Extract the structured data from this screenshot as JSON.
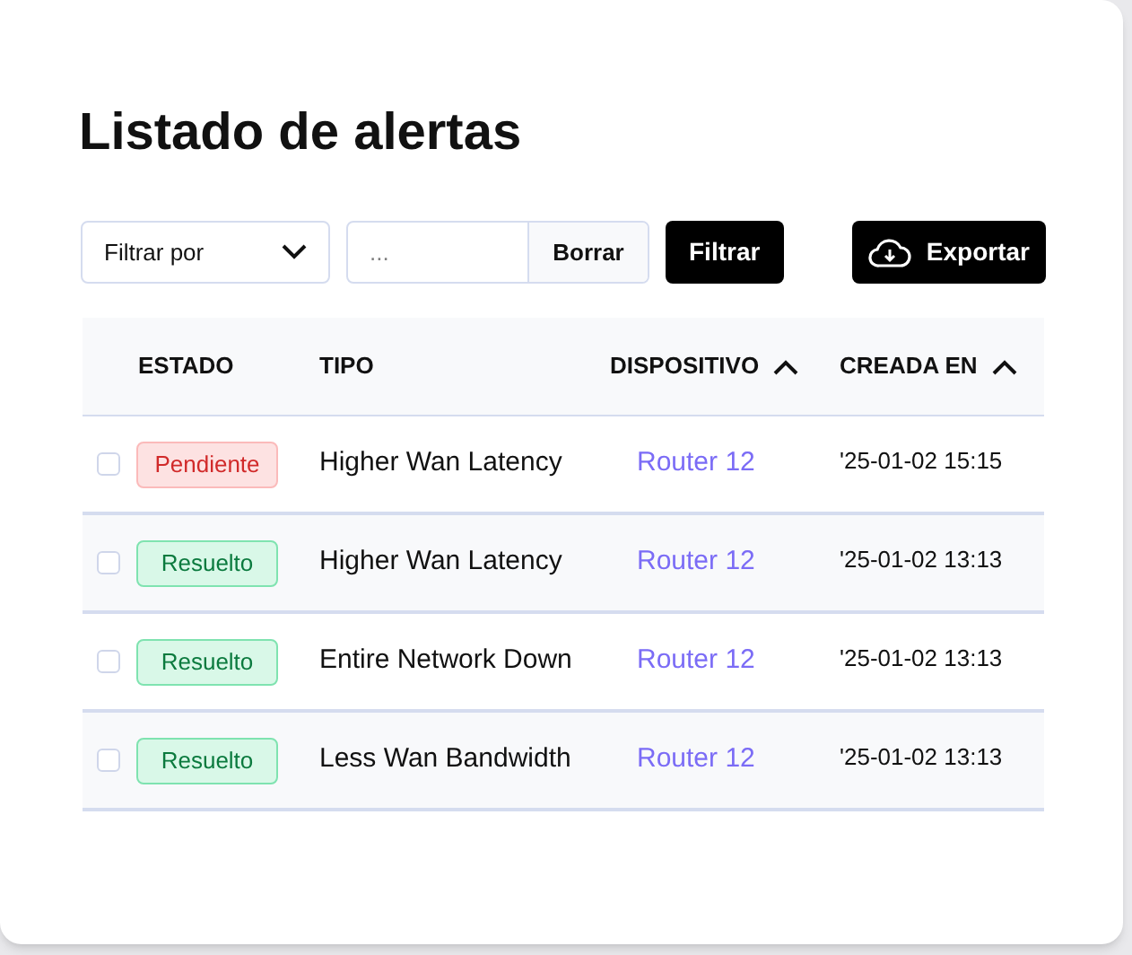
{
  "title": "Listado de alertas",
  "filter": {
    "select": "Filtrar por",
    "placeholder": "...",
    "clear_button": "Borrar",
    "filter_button": "Filtrar"
  },
  "export_button": "Exportar",
  "table": {
    "columns": [
      {
        "label": "ESTADO",
        "sortable": false
      },
      {
        "label": "TIPO",
        "sortable": false
      },
      {
        "label": "DISPOSITIVO",
        "sortable": true
      },
      {
        "label": "CREADA EN",
        "sortable": true
      }
    ],
    "rows": [
      {
        "checked": false,
        "status": {
          "kind": "pending",
          "label": "Pendiente"
        },
        "type": "Higher Wan Latency",
        "device": "Router 12",
        "created": "'25-01-02 15:15"
      },
      {
        "checked": false,
        "status": {
          "kind": "resolved",
          "label": "Resuelto"
        },
        "type": "Higher Wan Latency",
        "device": "Router 12",
        "created": "'25-01-02 13:13"
      },
      {
        "checked": false,
        "status": {
          "kind": "resolved",
          "label": "Resuelto"
        },
        "type": "Entire Network Down",
        "device": "Router 12",
        "created": "'25-01-02 13:13"
      },
      {
        "checked": false,
        "status": {
          "kind": "resolved",
          "label": "Resuelto"
        },
        "type": "Less Wan Bandwidth",
        "device": "Router 12",
        "created": "'25-01-02 13:13"
      }
    ]
  }
}
